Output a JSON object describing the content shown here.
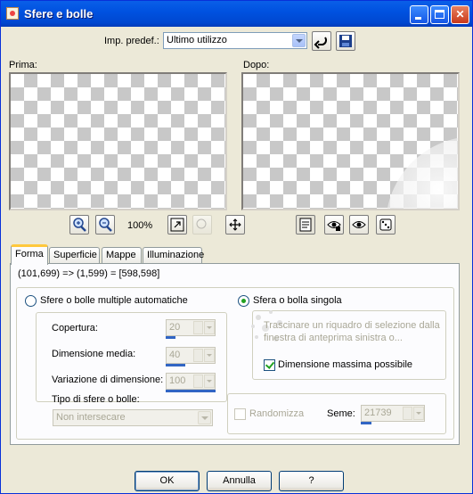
{
  "window": {
    "title": "Sfere e bolle",
    "minimize_icon": "minimize-icon",
    "maximize_icon": "maximize-icon",
    "close_icon": "close-icon",
    "close_glyph": "✕"
  },
  "preset": {
    "label": "Imp. predef.:",
    "selected": "Ultimo utilizzo"
  },
  "previews": {
    "before_label": "Prima:",
    "after_label": "Dopo:"
  },
  "zoom": {
    "level": "100%"
  },
  "tabs": [
    {
      "label": "Forma",
      "active": true
    },
    {
      "label": "Superficie",
      "active": false
    },
    {
      "label": "Mappe",
      "active": false
    },
    {
      "label": "Illuminazione",
      "active": false
    }
  ],
  "coords_text": "(101,699) => (1,599) = [598,598]",
  "auto": {
    "radio_label": "Sfere o bolle multiple automatiche",
    "selected": false,
    "copertura_label": "Copertura:",
    "copertura_value": "20",
    "dimensione_label": "Dimensione media:",
    "dimensione_value": "40",
    "variazione_label": "Variazione di dimensione:",
    "variazione_value": "100",
    "tipo_label": "Tipo di sfere o bolle:",
    "tipo_value": "Non intersecare",
    "randomizza_label": "Randomizza",
    "seme_label": "Seme:",
    "seme_value": "21739"
  },
  "single": {
    "radio_label": "Sfera o bolla singola",
    "selected": true,
    "hint_line1": "Trascinare un riquadro di selezione dalla",
    "hint_line2": "finestra di anteprima sinistra o...",
    "max_label": "Dimensione massima possibile",
    "max_checked": true
  },
  "buttons": {
    "ok": "OK",
    "cancel": "Annulla",
    "help": "?"
  },
  "colors": {
    "titlebar": "#0054e3",
    "dialog_bg": "#ece9d8",
    "selection_blue": "#3165c4",
    "check_green": "#21a121",
    "tab_highlight": "#ffc83c"
  }
}
